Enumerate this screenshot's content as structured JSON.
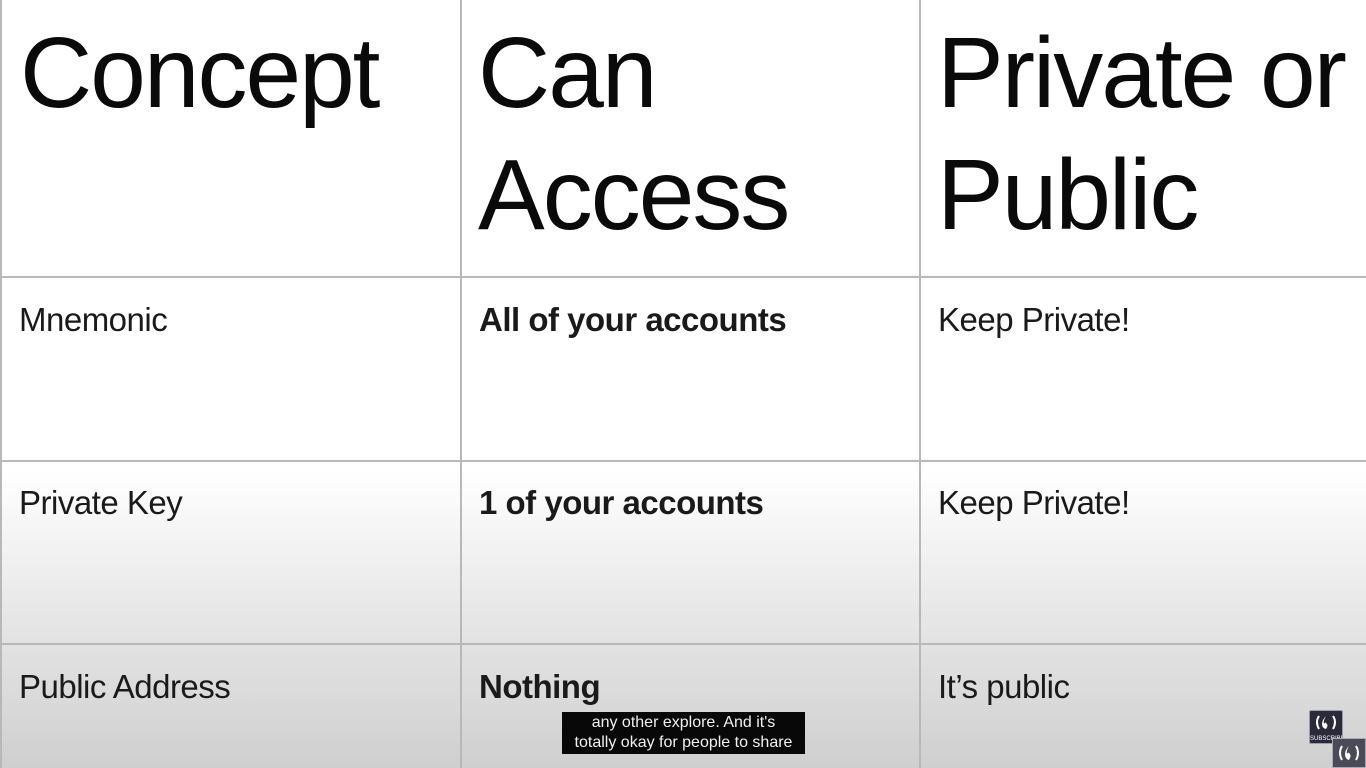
{
  "table": {
    "headers": [
      "Concept",
      "Can Access",
      "Private or Public"
    ],
    "header_lines": {
      "col1": [
        "Concept"
      ],
      "col2": [
        "Can",
        "Access"
      ],
      "col3": [
        "Private or",
        "Public"
      ]
    },
    "rows": [
      {
        "concept": "Mnemonic",
        "access": "All of your accounts",
        "visibility": "Keep Private!"
      },
      {
        "concept": "Private Key",
        "access": "1 of your accounts",
        "visibility": "Keep Private!"
      },
      {
        "concept": "Public Address",
        "access": "Nothing",
        "visibility": "It’s public"
      }
    ]
  },
  "caption": {
    "line1": "any other explore. And it's",
    "line2": "totally okay for people to share"
  },
  "watermark": {
    "subscribe_label": "SUBSCRIBE",
    "icon": "freecodecamp-flame-icon"
  }
}
